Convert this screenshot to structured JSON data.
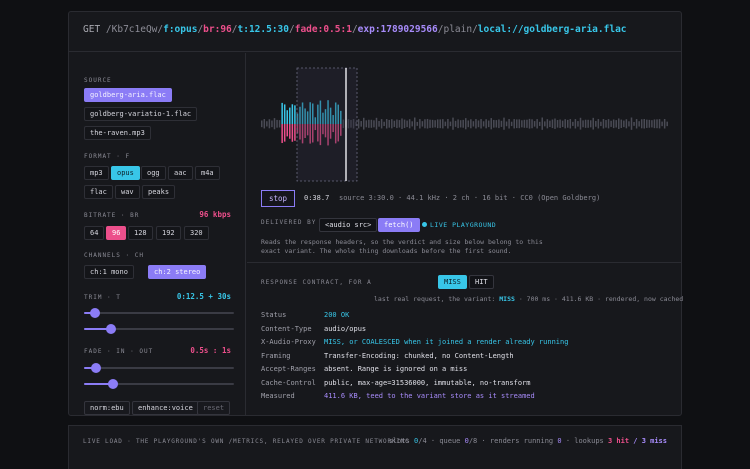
{
  "url": {
    "method": "GET",
    "path_prefix": "/Kb7c1eQw/",
    "format": "f:opus",
    "sep1": "/",
    "bitrate": "br:96",
    "sep2": "/",
    "trim": "t:12.5:30",
    "sep3": "/",
    "fade": "fade:0.5:1",
    "sep4": "/",
    "expiry": "exp:1789029566",
    "middle": "/plain/",
    "source": "local://goldberg-aria.flac"
  },
  "controls": {
    "source_label": "SOURCE",
    "sources": [
      "goldberg-aria.flac",
      "goldberg-variatio-1.flac",
      "the-raven.mp3"
    ],
    "format_label": "FORMAT · F",
    "formats": [
      "mp3",
      "opus",
      "ogg",
      "aac",
      "m4a",
      "flac",
      "wav",
      "peaks"
    ],
    "bitrate_label": "BITRATE · BR",
    "bitrate_value": "96 kbps",
    "bitrates": [
      "64",
      "96",
      "128",
      "192",
      "320"
    ],
    "channels_label": "CHANNELS · CH",
    "channels": [
      "ch:1 mono",
      "ch:2 stereo"
    ],
    "trim_label": "TRIM · T",
    "trim_value": "0:12.5 + 30s",
    "trim_start": 0.07,
    "trim_end": 0.18,
    "fade_label": "FADE · IN · OUT",
    "fade_value": "0.5s : 1s",
    "fade_in": 0.08,
    "fade_out": 0.19,
    "extra_buttons": [
      "norm:ebu",
      "enhance:voice",
      "reset"
    ]
  },
  "player": {
    "stop_label": "stop",
    "position": "0:38.7",
    "meta": "source 3:30.0 · 44.1 kHz · 2 ch · 16 bit · CC0 (Open Goldberg)",
    "delivered_by": "DELIVERED BY",
    "audio_src": "<audio src>",
    "fetch": "fetch()",
    "live": "LIVE PLAYGROUND",
    "note": "Reads the response headers, so the verdict and size below belong to this exact variant. The whole thing downloads before the first sound."
  },
  "contract": {
    "label": "RESPONSE CONTRACT, FOR A",
    "miss": "MISS",
    "hit": "HIT",
    "last_prefix": "last real request, the variant:",
    "last_miss": "MISS",
    "last_suffix": "· 700 ms · 411.6 KB · rendered, now cached",
    "headers": [
      {
        "k": "Status",
        "v": "200 OK"
      },
      {
        "k": "Content-Type",
        "v": "audio/opus"
      },
      {
        "k": "X-Audio-Proxy",
        "v": "MISS, or COALESCED when it joined a render already running"
      },
      {
        "k": "Framing",
        "v": "Transfer-Encoding: chunked, no Content-Length"
      },
      {
        "k": "Accept-Ranges",
        "v": "absent. Range is ignored on a miss"
      },
      {
        "k": "Cache-Control",
        "v": "public, max-age=31536000, immutable, no-transform"
      },
      {
        "k": "Measured",
        "v": "411.6 KB, teed to the variant store as it streamed"
      }
    ]
  },
  "footer": {
    "left": "LIVE LOAD · THE PLAYGROUND'S OWN /METRICS, RELAYED OVER PRIVATE NETWORKING",
    "slots_label": "slots",
    "slots_used": "0",
    "slots_total": "/4",
    "queue_label": "· queue",
    "queue_used": "0",
    "queue_total": "/8",
    "renders_label": "· renders running",
    "renders": "0",
    "lookups_label": "· lookups",
    "hits": "3 hit",
    "sep": "/",
    "misses": "3 miss"
  },
  "colors": {
    "violet": "#8b7cf6",
    "cyan": "#38c6e8",
    "pink": "#ec4f8b"
  }
}
